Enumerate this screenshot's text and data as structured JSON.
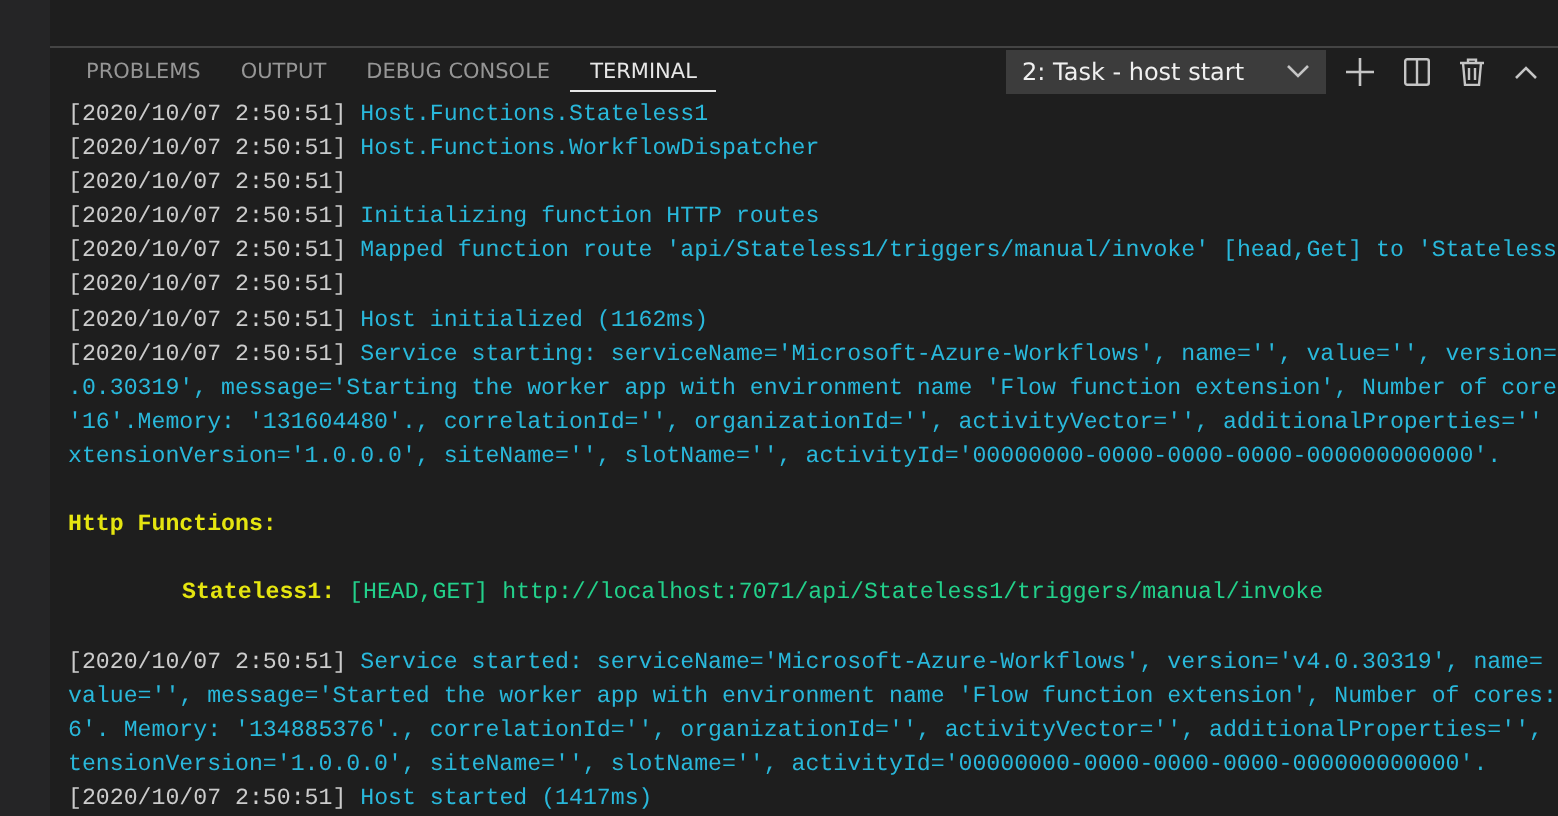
{
  "panel": {
    "tabs": [
      {
        "label": "PROBLEMS",
        "selected": false
      },
      {
        "label": "OUTPUT",
        "selected": false
      },
      {
        "label": "DEBUG CONSOLE",
        "selected": false
      },
      {
        "label": "TERMINAL",
        "selected": true
      }
    ],
    "terminal_select": {
      "value": "2: Task - host start"
    }
  },
  "terminal": {
    "lines": [
      {
        "kind": "log",
        "timestamp": "[2020/10/07 2:50:51]",
        "message": "Host.Functions.Stateless1"
      },
      {
        "kind": "log",
        "timestamp": "[2020/10/07 2:50:51]",
        "message": "Host.Functions.WorkflowDispatcher"
      },
      {
        "kind": "log",
        "timestamp": "[2020/10/07 2:50:51]"
      },
      {
        "kind": "log",
        "timestamp": "[2020/10/07 2:50:51]",
        "message": "Initializing function HTTP routes"
      },
      {
        "kind": "log",
        "timestamp": "[2020/10/07 2:50:51]",
        "message": "Mapped function route 'api/Stateless1/triggers/manual/invoke' [head,Get] to 'Stateless"
      },
      {
        "kind": "log",
        "timestamp": "[2020/10/07 2:50:51]"
      },
      {
        "kind": "log",
        "timestamp": "[2020/10/07 2:50:51]",
        "message": "Host initialized (1162ms)"
      },
      {
        "kind": "log",
        "timestamp": "[2020/10/07 2:50:51]",
        "message": "Service starting: serviceName='Microsoft-Azure-Workflows', name='', value='', version="
      },
      {
        "kind": "continuation",
        "text": ".0.30319', message='Starting the worker app with environment name 'Flow function extension', Number of core"
      },
      {
        "kind": "continuation",
        "text": "'16'.Memory: '131604480'., correlationId='', organizationId='', activityVector='', additionalProperties=''"
      },
      {
        "kind": "continuation",
        "text": "xtensionVersion='1.0.0.0', siteName='', slotName='', activityId='00000000-0000-0000-0000-000000000000'."
      },
      {
        "kind": "blank"
      },
      {
        "kind": "heading",
        "text": "Http Functions:"
      },
      {
        "kind": "blank"
      },
      {
        "kind": "route",
        "name": "Stateless1:",
        "methods": "[HEAD,GET]",
        "url": "http://localhost:7071/api/Stateless1/triggers/manual/invoke"
      },
      {
        "kind": "blank"
      },
      {
        "kind": "log",
        "timestamp": "[2020/10/07 2:50:51]",
        "message": "Service started: serviceName='Microsoft-Azure-Workflows', version='v4.0.30319', name="
      },
      {
        "kind": "continuation",
        "text": "value='', message='Started the worker app with environment name 'Flow function extension', Number of cores:"
      },
      {
        "kind": "continuation",
        "text": "6'. Memory: '134885376'., correlationId='', organizationId='', activityVector='', additionalProperties='',"
      },
      {
        "kind": "continuation",
        "text": "tensionVersion='1.0.0.0', siteName='', slotName='', activityId='00000000-0000-0000-0000-000000000000'."
      },
      {
        "kind": "log",
        "timestamp": "[2020/10/07 2:50:51]",
        "message": "Host started (1417ms)"
      }
    ]
  }
}
